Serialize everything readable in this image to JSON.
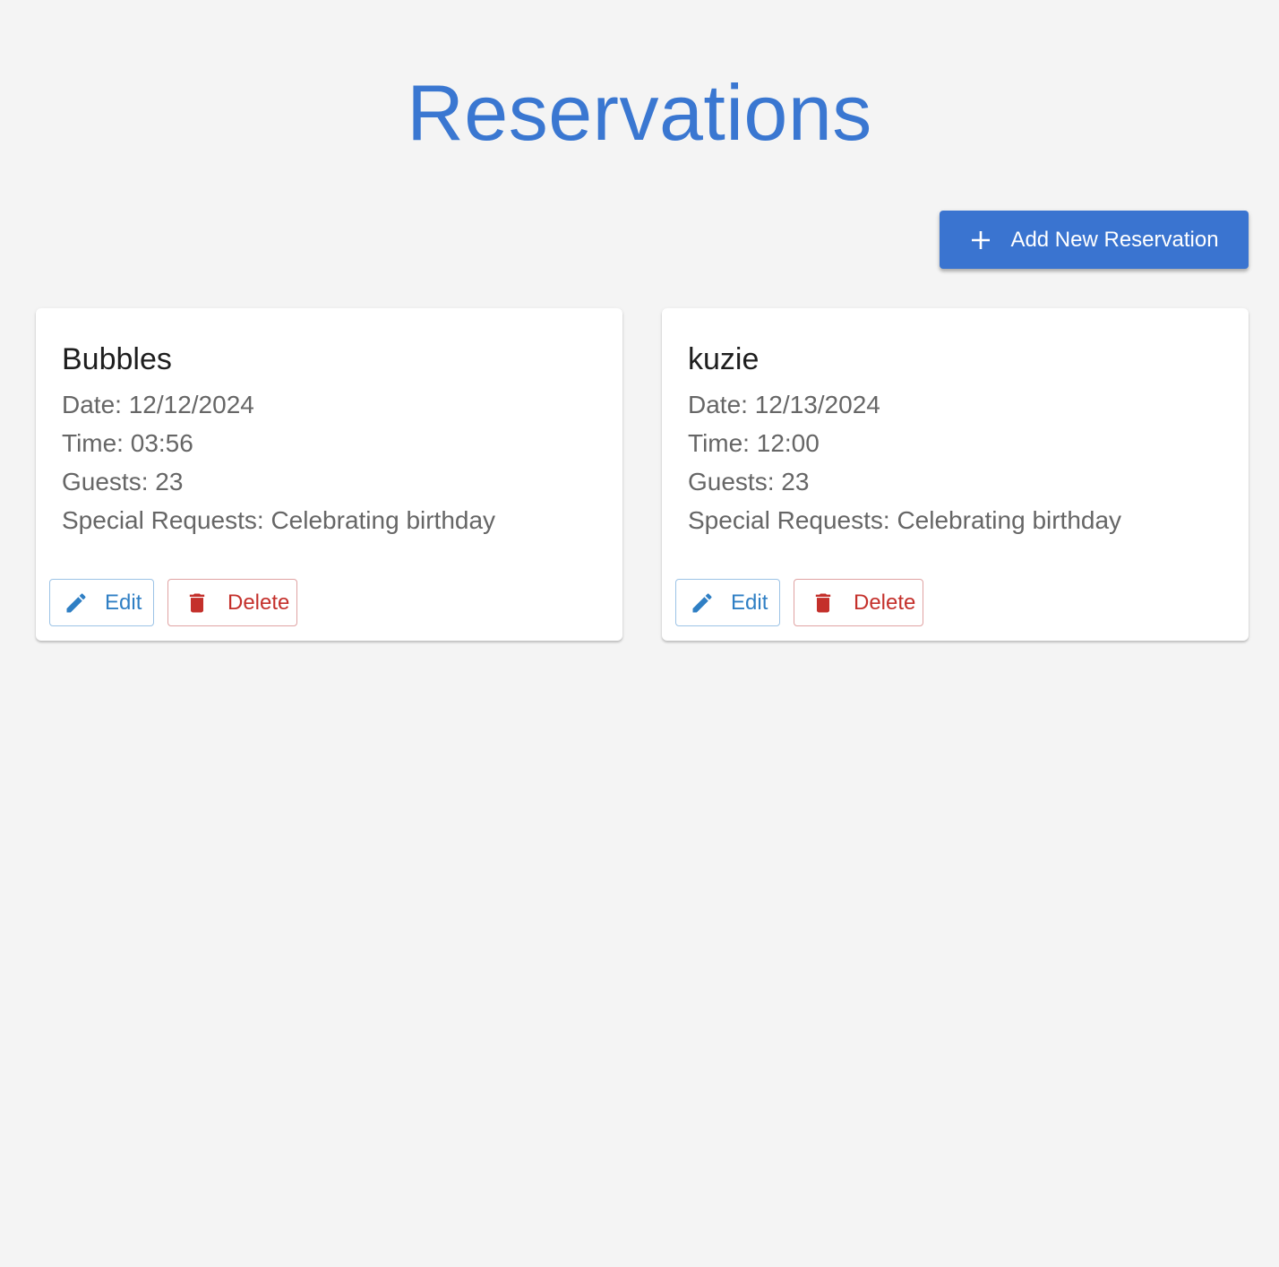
{
  "header": {
    "title": "Reservations"
  },
  "toolbar": {
    "add_label": "Add New Reservation",
    "add_icon": "plus-icon"
  },
  "colors": {
    "primary": "#3a74d0",
    "title": "#3a77d1",
    "edit": "#2f7fc4",
    "delete": "#c4302b",
    "background": "#f4f4f4"
  },
  "reservations": [
    {
      "name": "Bubbles",
      "date": "Date: 12/12/2024",
      "time": "Time: 03:56",
      "guests": "Guests: 23",
      "special": "Special Requests: Celebrating birthday",
      "edit_label": "Edit",
      "delete_label": "Delete"
    },
    {
      "name": "kuzie",
      "date": "Date: 12/13/2024",
      "time": "Time: 12:00",
      "guests": "Guests: 23",
      "special": "Special Requests: Celebrating birthday",
      "edit_label": "Edit",
      "delete_label": "Delete"
    }
  ]
}
